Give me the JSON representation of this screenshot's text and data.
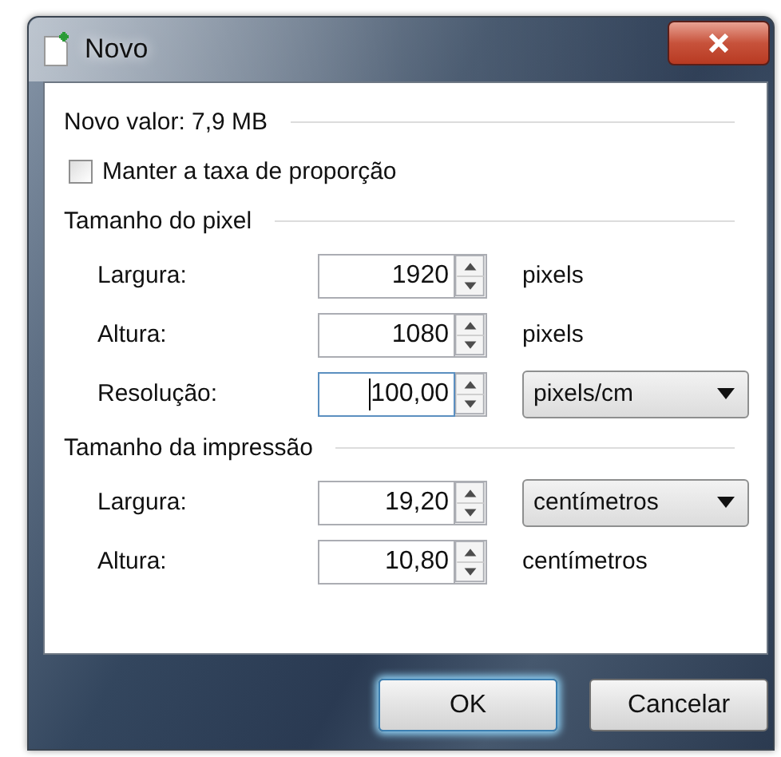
{
  "window": {
    "title": "Novo"
  },
  "new_size": "Novo valor: 7,9 MB",
  "keep_ratio": {
    "label": "Manter a taxa de proporção",
    "checked": false
  },
  "sections": [
    {
      "title": "Tamanho do pixel",
      "rows": [
        {
          "label": "Largura:",
          "value": "1920",
          "focused": false,
          "unit": {
            "kind": "text",
            "value": "pixels"
          }
        },
        {
          "label": "Altura:",
          "value": "1080",
          "focused": false,
          "unit": {
            "kind": "text",
            "value": "pixels"
          }
        },
        {
          "label": "Resolução:",
          "value": "100,00",
          "focused": true,
          "unit": {
            "kind": "dropdown",
            "value": "pixels/cm"
          }
        }
      ]
    },
    {
      "title": "Tamanho da impressão",
      "rows": [
        {
          "label": "Largura:",
          "value": "19,20",
          "focused": false,
          "unit": {
            "kind": "dropdown",
            "value": "centímetros"
          }
        },
        {
          "label": "Altura:",
          "value": "10,80",
          "focused": false,
          "unit": {
            "kind": "text",
            "value": "centímetros"
          }
        }
      ]
    }
  ],
  "buttons": [
    {
      "label": "OK",
      "default": true
    },
    {
      "label": "Cancelar",
      "default": false
    }
  ]
}
